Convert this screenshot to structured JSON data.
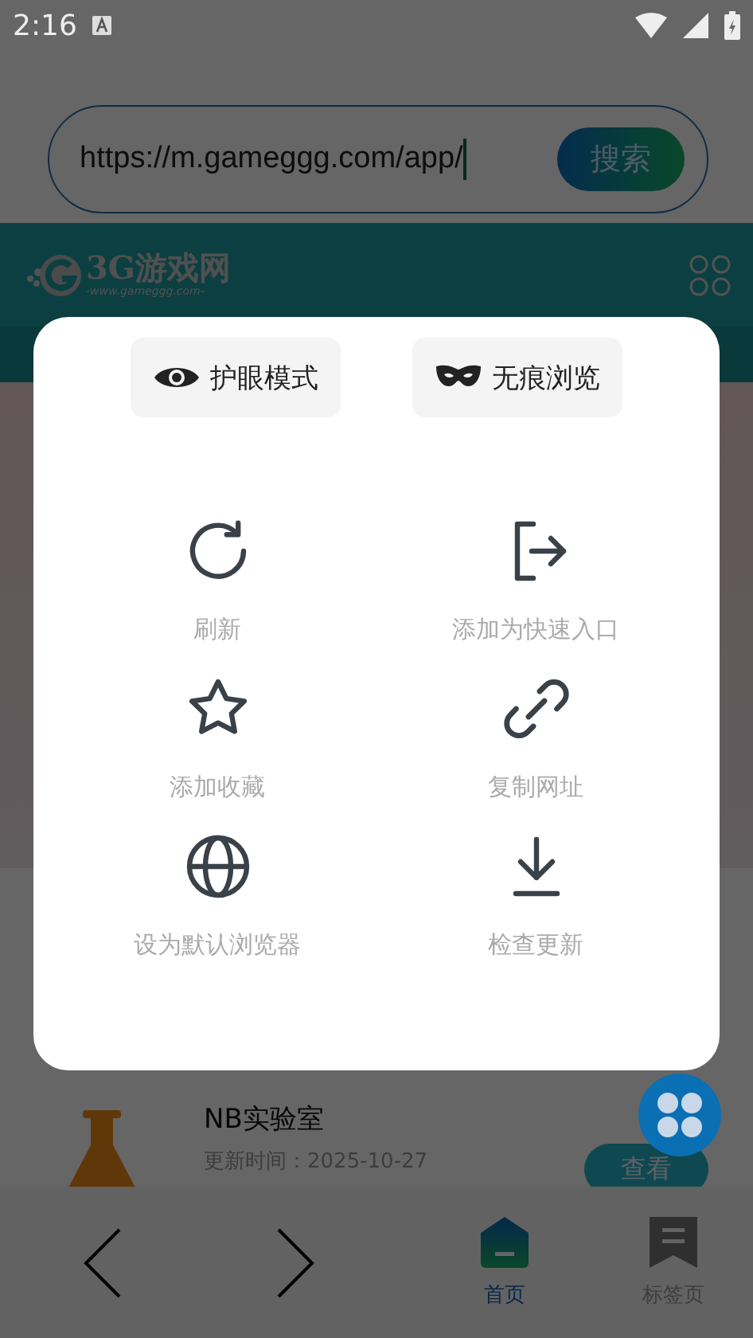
{
  "status_bar": {
    "time": "2:16"
  },
  "address_bar": {
    "value": "https://m.gameggg.com/app/",
    "button": "搜索"
  },
  "site_header": {
    "logo_text": "3G游戏网",
    "logo_url": "-www.gameggg.com-"
  },
  "menu": {
    "toggles": [
      {
        "label": "护眼模式",
        "kind": "eye"
      },
      {
        "label": "无痕浏览",
        "kind": "mask"
      }
    ],
    "actions": [
      {
        "label": "刷新",
        "kind": "refresh"
      },
      {
        "label": "添加为快速入口",
        "kind": "shortcut"
      },
      {
        "label": "添加收藏",
        "kind": "favorite"
      },
      {
        "label": "复制网址",
        "kind": "link"
      },
      {
        "label": "设为默认浏览器",
        "kind": "browser"
      },
      {
        "label": "检查更新",
        "kind": "update"
      }
    ]
  },
  "app_card": {
    "name": "NB实验室",
    "updated": "更新时间：2025-10-27",
    "button": "查看"
  },
  "bottom_nav": {
    "tabs": [
      {
        "label": "首页",
        "selected": true
      },
      {
        "label": "标签页",
        "selected": false
      }
    ]
  }
}
